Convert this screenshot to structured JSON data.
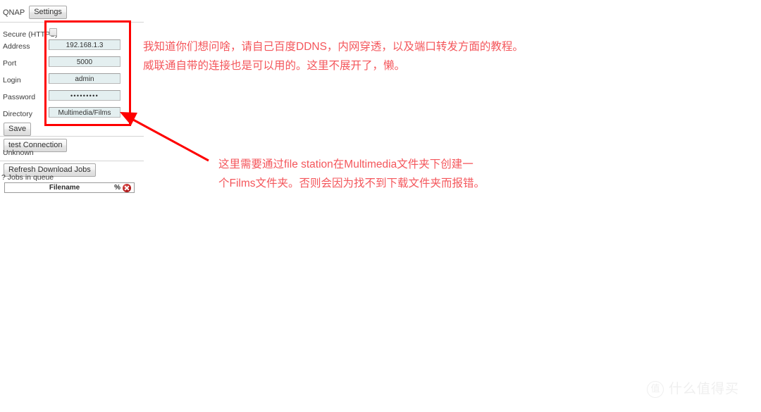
{
  "panel": {
    "tab_plain_label": "QNAP",
    "settings_button_label": "Settings",
    "fields": {
      "secure_label": "Secure (HTTPS)",
      "secure_checked": false,
      "address_label": "Address",
      "address_value": "192.168.1.3",
      "port_label": "Port",
      "port_value": "5000",
      "login_label": "Login",
      "login_value": "admin",
      "password_label": "Password",
      "password_value": "•••••••••",
      "directory_label": "Directory",
      "directory_value": "Multimedia/Films"
    },
    "save_button_label": "Save",
    "test_connection_button_label": "test Connection",
    "connection_status": "Unknown",
    "refresh_jobs_button_label": "Refresh Download Jobs",
    "jobs_queue_text": "? Jobs in queue",
    "jobs_table": {
      "col_filename": "Filename",
      "col_percent": "%",
      "delete_icon": "delete-circle-icon"
    }
  },
  "annotations": {
    "top_line_1": "我知道你们想问啥，请自己百度DDNS，内网穿透，以及端口转发方面的教程。",
    "top_line_2": "威联通自带的连接也是可以用的。这里不展开了，懒。",
    "bottom_line_1": "这里需要通过file station在Multimedia文件夹下创建一",
    "bottom_line_2": "个Films文件夹。否则会因为找不到下载文件夹而报错。",
    "highlight_color": "#fe0000",
    "text_color": "#f4565b"
  },
  "watermark": {
    "badge": "值",
    "text": "什么值得买"
  }
}
